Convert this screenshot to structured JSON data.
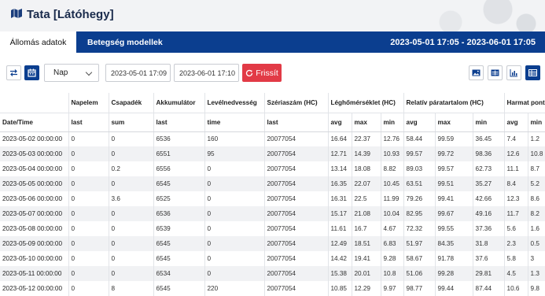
{
  "header": {
    "title": "Tata [Látóhegy]",
    "icon": "map-icon"
  },
  "tabs": {
    "station_data": "Állomás adatok",
    "disease_models": "Betegség modellek"
  },
  "date_range": "2023-05-01 17:05 - 2023-06-01 17:05",
  "toolbar": {
    "period_label": "Nap",
    "start": "2023-05-01 17:09",
    "end": "2023-06-01 17:10",
    "refresh_label": "Frissít"
  },
  "colors": {
    "primary": "#0b3e8f",
    "refresh": "#e23a46"
  },
  "table": {
    "groups": [
      "Napelem",
      "Csapadék",
      "Akkumulátor",
      "Levélnedvesség",
      "Szériaszám (HC)",
      "Léghőmérséklet (HC)",
      "Relatív páratartalom (HC)",
      "Harmat pont"
    ],
    "sub": [
      "Date/Time",
      "last",
      "sum",
      "last",
      "time",
      "last",
      "avg",
      "max",
      "min",
      "avg",
      "max",
      "min",
      "avg",
      "min"
    ],
    "rows": [
      [
        "2023-05-02 00:00:00",
        "0",
        "0",
        "6536",
        "160",
        "20077054",
        "16.64",
        "22.37",
        "12.76",
        "58.44",
        "99.59",
        "36.45",
        "7.4",
        "1.2"
      ],
      [
        "2023-05-03 00:00:00",
        "0",
        "0",
        "6551",
        "95",
        "20077054",
        "12.71",
        "14.39",
        "10.93",
        "99.57",
        "99.72",
        "98.36",
        "12.6",
        "10.8"
      ],
      [
        "2023-05-04 00:00:00",
        "0",
        "0.2",
        "6556",
        "0",
        "20077054",
        "13.14",
        "18.08",
        "8.82",
        "89.03",
        "99.57",
        "62.73",
        "11.1",
        "8.7"
      ],
      [
        "2023-05-05 00:00:00",
        "0",
        "0",
        "6545",
        "0",
        "20077054",
        "16.35",
        "22.07",
        "10.45",
        "63.51",
        "99.51",
        "35.27",
        "8.4",
        "5.2"
      ],
      [
        "2023-05-06 00:00:00",
        "0",
        "3.6",
        "6525",
        "0",
        "20077054",
        "16.31",
        "22.5",
        "11.99",
        "79.26",
        "99.41",
        "42.66",
        "12.3",
        "8.6"
      ],
      [
        "2023-05-07 00:00:00",
        "0",
        "0",
        "6536",
        "0",
        "20077054",
        "15.17",
        "21.08",
        "10.04",
        "82.95",
        "99.67",
        "49.16",
        "11.7",
        "8.2"
      ],
      [
        "2023-05-08 00:00:00",
        "0",
        "0",
        "6539",
        "0",
        "20077054",
        "11.61",
        "16.7",
        "4.67",
        "72.32",
        "99.55",
        "37.36",
        "5.6",
        "1.6"
      ],
      [
        "2023-05-09 00:00:00",
        "0",
        "0",
        "6545",
        "0",
        "20077054",
        "12.49",
        "18.51",
        "6.83",
        "51.97",
        "84.35",
        "31.8",
        "2.3",
        "0.5"
      ],
      [
        "2023-05-10 00:00:00",
        "0",
        "0",
        "6545",
        "0",
        "20077054",
        "14.42",
        "19.41",
        "9.28",
        "58.67",
        "91.78",
        "37.6",
        "5.8",
        "3"
      ],
      [
        "2023-05-11 00:00:00",
        "0",
        "0",
        "6534",
        "0",
        "20077054",
        "15.38",
        "20.01",
        "10.8",
        "51.06",
        "99.28",
        "29.81",
        "4.5",
        "1.3"
      ],
      [
        "2023-05-12 00:00:00",
        "0",
        "8",
        "6545",
        "220",
        "20077054",
        "10.85",
        "12.29",
        "9.97",
        "98.77",
        "99.44",
        "87.44",
        "10.6",
        "9.8"
      ]
    ]
  }
}
